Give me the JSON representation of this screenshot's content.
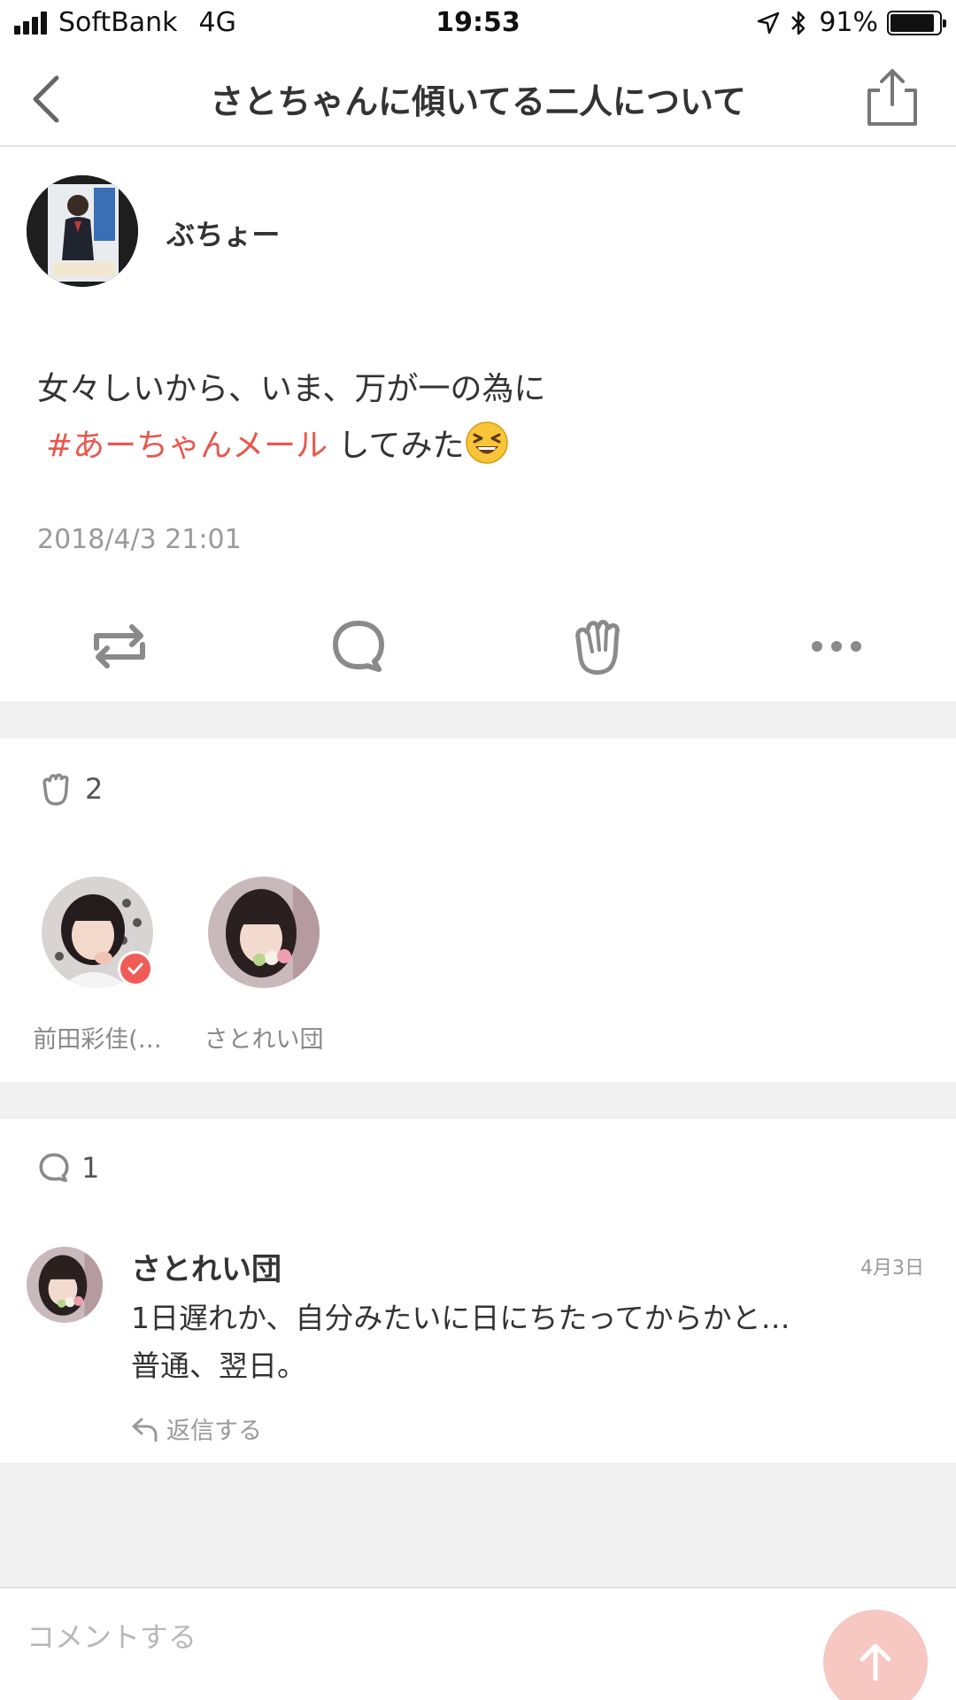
{
  "status_bar": {
    "carrier": "SoftBank",
    "network": "4G",
    "time": "19:53",
    "battery_percent": "91%",
    "battery_level": 0.91
  },
  "nav": {
    "title": "さとちゃんに傾いてる二人について",
    "back_icon": "chevron-left-icon",
    "share_icon": "share-icon"
  },
  "post": {
    "author": "ぶちょー",
    "text_line1": "女々しいから、いま、万が一の為に",
    "hashtag": "#あーちゃんメール",
    "text_after_hashtag": "してみた",
    "date": "2018/4/3 21:01"
  },
  "likes": {
    "count": "2",
    "users": [
      {
        "name": "前田彩佳(…",
        "verified": true
      },
      {
        "name": "さとれい団",
        "verified": false
      }
    ]
  },
  "comments": {
    "count": "1",
    "items": [
      {
        "author": "さとれい団",
        "date": "4月3日",
        "line1": "1日遅れか、自分みたいに日にちたってからかと…",
        "line2": "普通、翌日。",
        "reply_label": "返信する"
      }
    ]
  },
  "composer": {
    "placeholder": "コメントする"
  },
  "colors": {
    "accent": "#e8574c",
    "icon_gray": "#9b9b9b",
    "separator": "#f1f1f1",
    "send_button": "#f7c7c2"
  }
}
